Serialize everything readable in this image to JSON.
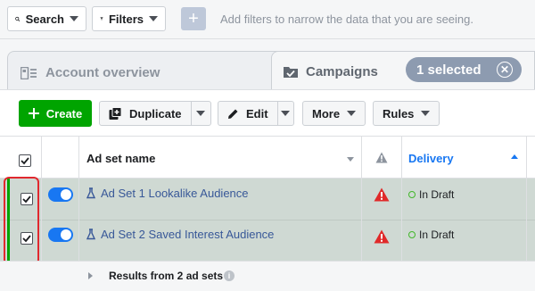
{
  "filter_bar": {
    "search_label": "Search",
    "filters_label": "Filters",
    "add_icon": "plus-icon",
    "hint": "Add filters to narrow the data that you are seeing."
  },
  "tabs": {
    "account_overview": "Account overview",
    "campaigns": "Campaigns",
    "selected_label": "1 selected"
  },
  "toolbar": {
    "create_label": "Create",
    "duplicate_label": "Duplicate",
    "edit_label": "Edit",
    "more_label": "More",
    "rules_label": "Rules"
  },
  "table": {
    "columns": {
      "name": "Ad set name",
      "delivery": "Delivery"
    },
    "rows": [
      {
        "name": "Ad Set 1 Lookalike Audience",
        "status": "In Draft",
        "checked": true,
        "on": true
      },
      {
        "name": "Ad Set 2 Saved Interest Audience",
        "status": "In Draft",
        "checked": true,
        "on": true
      }
    ],
    "results_label": "Results from 2 ad sets"
  },
  "colors": {
    "accent": "#1877f2",
    "create_green": "#00a400",
    "warning_red": "#e02a2a",
    "highlight_red": "#e0282e",
    "selected_row": "#cfd9d3"
  }
}
